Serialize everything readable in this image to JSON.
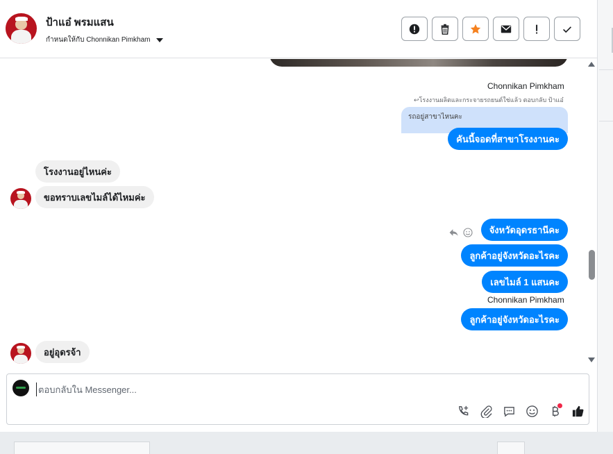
{
  "header": {
    "contact_name": "ป้าแอ๋ พรมแสน",
    "assigned_label": "กำหนดให้กับ Chonnikan Pimkham",
    "actions": [
      {
        "name": "report-button",
        "icon": "alert-circle-icon"
      },
      {
        "name": "delete-button",
        "icon": "trash-icon"
      },
      {
        "name": "star-button",
        "icon": "star-icon"
      },
      {
        "name": "mark-unread-button",
        "icon": "envelope-icon"
      },
      {
        "name": "spam-button",
        "icon": "exclamation-icon"
      },
      {
        "name": "done-button",
        "icon": "check-icon"
      }
    ]
  },
  "conversation": {
    "agent_name_1": "Chonnikan Pimkham",
    "reply_note": "↩โรงงานผลิตและกระจายรถยนต์ใช่แล้ว ตอบกลับ ป้าแอ๋",
    "quoted_text": "รถอยู่สาขาไหนคะ",
    "out_msg_1": "คันนี้จอดที่สาขาโรงงานคะ",
    "in_msg_1": "โรงงานอยู่ไหนค่ะ",
    "in_msg_2": "ขอทราบเลขไมล์ได้ไหมค่ะ",
    "out_msg_2": "จังหวัดอุดรธานีคะ",
    "out_msg_3": "ลูกค้าอยู่จังหวัดอะไรคะ",
    "out_msg_4": "เลขไมล์ 1 แสนคะ",
    "agent_name_2": "Chonnikan Pimkham",
    "out_msg_5": "ลูกค้าอยู่จังหวัดอะไรคะ",
    "in_msg_3": "อยู่อุดรจ้า"
  },
  "composer": {
    "placeholder": "ตอบกลับใน Messenger...",
    "tools": [
      "call-plus-icon",
      "paperclip-icon",
      "saved-reply-icon",
      "emoji-icon",
      "baht-payment-icon",
      "thumbs-up-icon"
    ]
  },
  "colors": {
    "outgoing_bubble": "#0084ff",
    "incoming_bubble": "#f0f0f0",
    "quoted_bubble": "#cfe1fb",
    "star": "#f5811f",
    "notification_dot": "#f02849"
  }
}
